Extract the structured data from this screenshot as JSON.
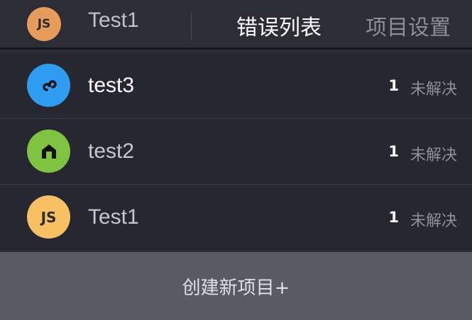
{
  "header": {
    "current_project": {
      "name": "Test1",
      "avatar_text": "JS",
      "avatar_color": "#e69c5b"
    },
    "tabs": [
      {
        "label": "错误列表",
        "active": true
      },
      {
        "label": "项目设置",
        "active": false
      }
    ]
  },
  "projects": [
    {
      "name": "test3",
      "icon": "mini-program-icon",
      "avatar_color": "#2e9cf0",
      "name_color": "#ffffff",
      "count": "1",
      "status": "未解决"
    },
    {
      "name": "test2",
      "icon": "nuxt-icon",
      "avatar_color": "#80c340",
      "name_color": "#c6c7cc",
      "count": "1",
      "status": "未解决"
    },
    {
      "name": "Test1",
      "icon": "js-icon",
      "avatar_text": "JS",
      "avatar_color": "#f7c063",
      "name_color": "#c6c7cc",
      "count": "1",
      "status": "未解决"
    }
  ],
  "create_button": {
    "label": "创建新项目+"
  },
  "colors": {
    "background": "#2c2d35",
    "row_background": "#262730",
    "button_background": "#5a5b62"
  }
}
